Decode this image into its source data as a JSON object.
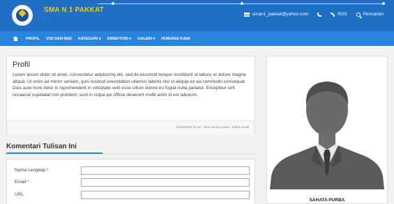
{
  "header": {
    "site_title": "SMA N 1 PAKKAT",
    "site_subtitle": ".",
    "email": "sman1_pakkat@yahoo.com",
    "rss_label": "RSS",
    "search_label": "Pencarian"
  },
  "nav": {
    "items": [
      "PROFIL",
      "VISI DAN MISI",
      "KATEGORI ▾",
      "DIREKTORI ▾",
      "GALERI ▾",
      "HUBUNGI KAMI"
    ]
  },
  "profile": {
    "title": "Profil",
    "body": "Lorem ipsum dolor sit amet, consectetur adipisicing elit, sed do eiusmod tempor incididunt ut labore et dolore magna aliqua. Ut enim ad minim veniam, quis nostrud exercitation ullamco laboris nisi ut aliquip ex ea commodo consequat. Duis aute irure dolor in reprehenderit in voluptate velit esse cillum dolore eu fugiat nulla pariatur. Excepteur sint occaecat cupidatat non proident, sunt in culpa qui officia deserunt mollit anim id est laborum.",
    "meta": "15/03/2020 19:18 - Oleh nervita purba - Dilihat 9 kali"
  },
  "comment": {
    "heading": "Komentari Tulisan Ini",
    "fields": [
      {
        "label": "Nama Lengkap",
        "required": "*",
        "value": ""
      },
      {
        "label": "Email",
        "required": "*",
        "value": ""
      },
      {
        "label": "URL",
        "required": "",
        "value": ""
      }
    ]
  },
  "sidebar": {
    "name": "SAHATA PURBA"
  },
  "colors": {
    "header_bg": "#1f6fc5",
    "nav_bg": "#2a84db",
    "title_yellow": "#f5c518",
    "accent": "#2a84db",
    "required_red": "#e0342a"
  }
}
